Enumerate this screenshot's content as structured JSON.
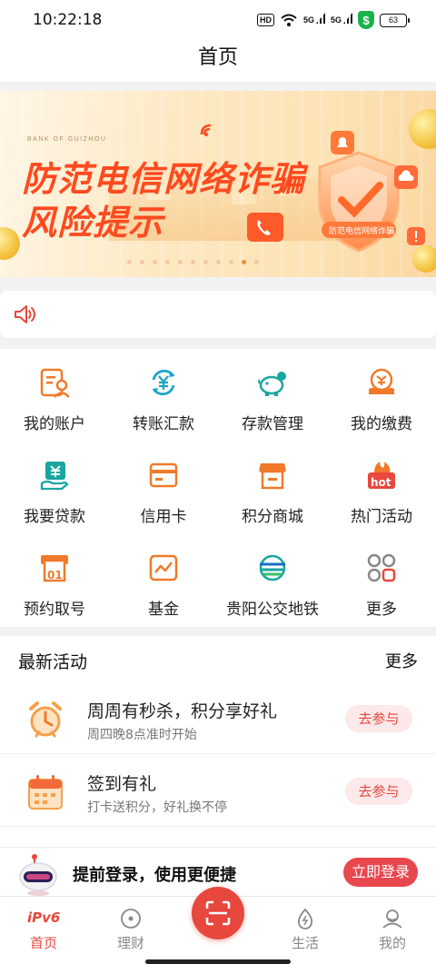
{
  "status": {
    "time": "10:22:18",
    "hd": "HD",
    "net1": "5G",
    "net2": "5G",
    "shield": "$",
    "battery": "63"
  },
  "header": {
    "title": "首页"
  },
  "banner": {
    "bank_en": "BANK OF GUIZHOU",
    "line1": "防范电信网络诈骗",
    "line2": "风险提示",
    "shield_text": "防范电信网络诈骗",
    "dot_count": 11,
    "active_dot": 9
  },
  "notice": {
    "icon": "speaker-icon",
    "text": ""
  },
  "services": [
    {
      "label": "我的账户",
      "icon": "account-icon"
    },
    {
      "label": "转账汇款",
      "icon": "transfer-icon"
    },
    {
      "label": "存款管理",
      "icon": "piggy-bank-icon"
    },
    {
      "label": "我的缴费",
      "icon": "payment-icon"
    },
    {
      "label": "我要贷款",
      "icon": "loan-icon"
    },
    {
      "label": "信用卡",
      "icon": "credit-card-icon"
    },
    {
      "label": "积分商城",
      "icon": "shop-icon"
    },
    {
      "label": "热门活动",
      "icon": "hot-icon"
    },
    {
      "label": "预约取号",
      "icon": "queue-ticket-icon"
    },
    {
      "label": "基金",
      "icon": "fund-chart-icon"
    },
    {
      "label": "贵阳公交地铁",
      "icon": "metro-icon"
    },
    {
      "label": "更多",
      "icon": "more-grid-icon"
    }
  ],
  "hot_badge": "hot",
  "ticket_number": "01",
  "activities": {
    "title": "最新活动",
    "more": "更多",
    "items": [
      {
        "title": "周周有秒杀，积分享好礼",
        "subtitle": "周四晚8点准时开始",
        "button": "去参与",
        "icon": "alarm-clock-icon"
      },
      {
        "title": "签到有礼",
        "subtitle": "打卡送积分，好礼换不停",
        "button": "去参与",
        "icon": "calendar-icon"
      }
    ]
  },
  "login_prompt": {
    "text": "提前登录，使用更便捷",
    "button": "立即登录"
  },
  "tabs": [
    {
      "label": "首页",
      "icon": "ipv6-home-icon",
      "badge": "iPv6",
      "active": true
    },
    {
      "label": "理财",
      "icon": "wealth-icon",
      "active": false
    },
    {
      "label": "",
      "icon": "scan-icon",
      "active": false
    },
    {
      "label": "生活",
      "icon": "life-icon",
      "active": false
    },
    {
      "label": "我的",
      "icon": "profile-icon",
      "active": false
    }
  ],
  "colors": {
    "brand_red": "#e8473d",
    "icon_orange": "#f07a2a",
    "icon_teal": "#1aa6a0",
    "banner_text": "#ff4a1f"
  }
}
